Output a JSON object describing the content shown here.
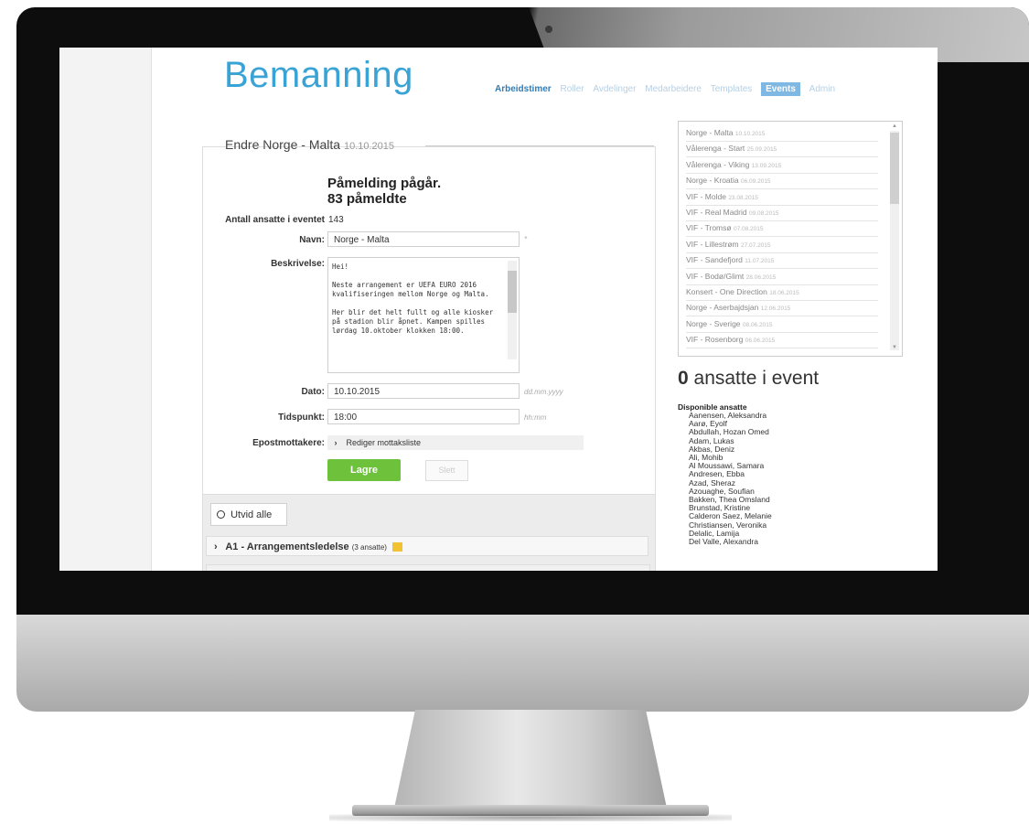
{
  "app": {
    "logo": "Bemanning"
  },
  "nav": {
    "items": [
      "Arbeidstimer",
      "Roller",
      "Avdelinger",
      "Medarbeidere",
      "Templates",
      "Events",
      "Admin"
    ]
  },
  "panel": {
    "title": "Endre Norge - Malta",
    "date": "10.10.2015"
  },
  "status": {
    "line1": "Påmelding pågår.",
    "line2": "83 påmeldte"
  },
  "form": {
    "antall_label": "Antall ansatte i eventet",
    "antall_value": "143",
    "navn_label": "Navn:",
    "navn_value": "Norge - Malta",
    "required_mark": "*",
    "beskrivelse_label": "Beskrivelse:",
    "beskrivelse_value": "Hei!\n\nNeste arrangement er UEFA EURO 2016 kvalifiseringen mellom Norge og Malta.\n\nHer blir det helt fullt og alle kiosker på stadion blir åpnet. Kampen spilles lørdag 10.oktober klokken 18:00.",
    "dato_label": "Dato:",
    "dato_value": "10.10.2015",
    "dato_hint": "dd.mm.yyyy",
    "tid_label": "Tidspunkt:",
    "tid_value": "18:00",
    "tid_hint": "hh:mm",
    "epost_label": "Epostmottakere:",
    "epost_link": "Rediger mottaksliste",
    "save_label": "Lagre",
    "other_label": "Slett"
  },
  "lower": {
    "expand_label": "Utvid alle",
    "section_title": "A1 - Arrangementsledelse",
    "section_count": "(3 ansatte)"
  },
  "events": [
    {
      "name": "Norge - Malta",
      "date": "10.10.2015"
    },
    {
      "name": "Vålerenga - Start",
      "date": "25.09.2015"
    },
    {
      "name": "Vålerenga - Viking",
      "date": "13.09.2015"
    },
    {
      "name": "Norge - Kroatia",
      "date": "06.09.2015"
    },
    {
      "name": "VIF - Molde",
      "date": "23.08.2015"
    },
    {
      "name": "VIF - Real Madrid",
      "date": "09.08.2015"
    },
    {
      "name": "VIF - Tromsø",
      "date": "07.08.2015"
    },
    {
      "name": "VIF - Lillestrøm",
      "date": "27.07.2015"
    },
    {
      "name": "VIF - Sandefjord",
      "date": "11.07.2015"
    },
    {
      "name": "VIF - Bodø/Glimt",
      "date": "28.06.2015"
    },
    {
      "name": "Konsert - One Direction",
      "date": "18.06.2015"
    },
    {
      "name": "Norge - Aserbajdsjan",
      "date": "12.06.2015"
    },
    {
      "name": "Norge - Sverige",
      "date": "08.06.2015"
    },
    {
      "name": "VIF - Rosenborg",
      "date": "06.06.2015"
    }
  ],
  "count": {
    "number": "0",
    "text": " ansatte i event"
  },
  "available": {
    "title": "Disponible ansatte",
    "names": [
      "Aanensen, Aleksandra",
      "Aarø, Eyolf",
      "Abdullah, Hozan Omed",
      "Adam, Lukas",
      "Akbas, Deniz",
      "Ali, Mohib",
      "Al Moussawi, Samara",
      "Andresen, Ebba",
      "Azad, Sheraz",
      "Azouaghe, Soufian",
      "Bakken, Thea Omsland",
      "Brunstad, Kristine",
      "Calderon Saez, Melanie",
      "Christiansen, Veronika",
      "Delalic, Lamija",
      "Del Valle, Alexandra"
    ]
  },
  "colors": {
    "logo": "#3aa3d6",
    "save": "#6ec13b",
    "nav_selected": "#7fb8e3"
  }
}
